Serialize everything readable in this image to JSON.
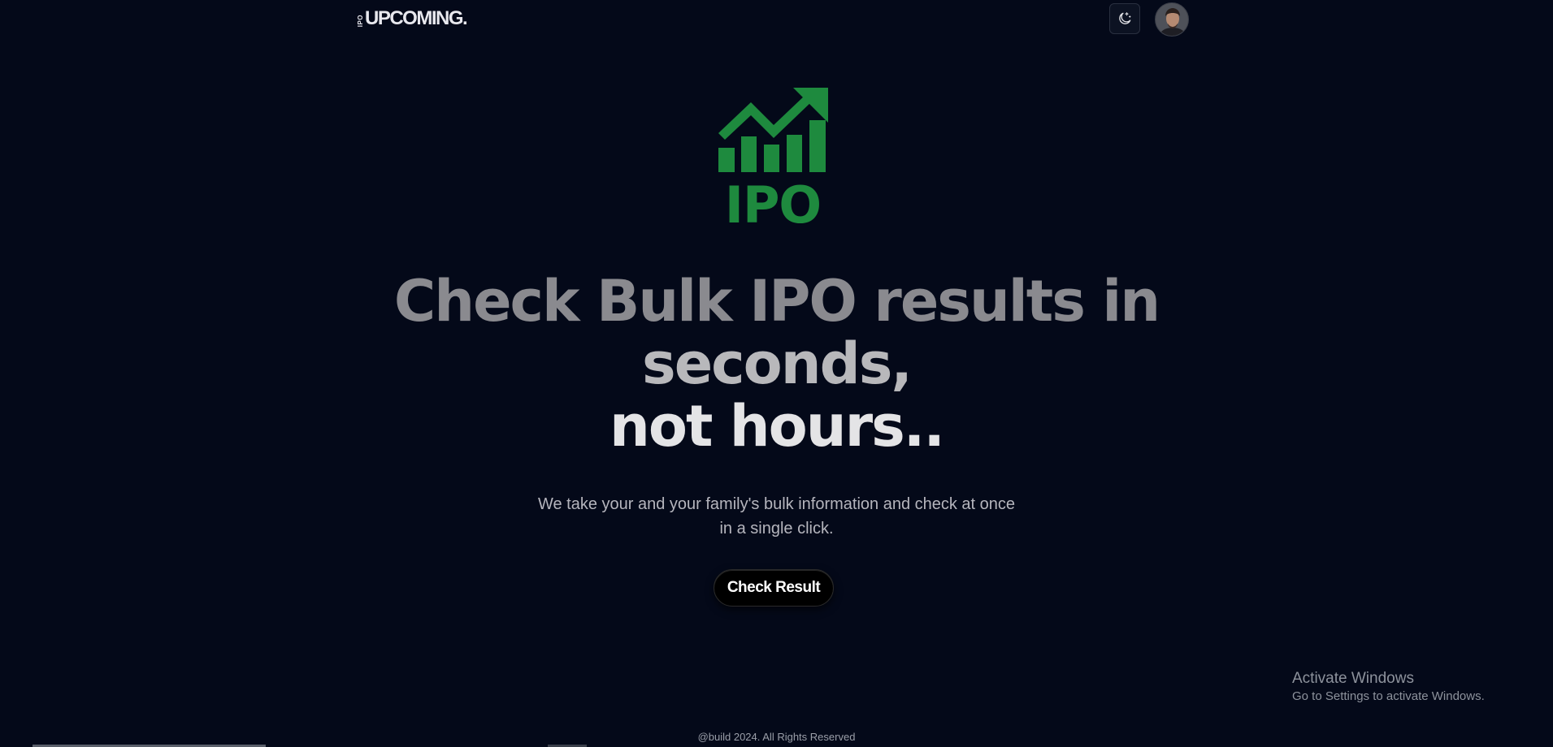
{
  "header": {
    "brand_small": "IPO",
    "brand_main": "UPCOMING.",
    "theme_toggle_icon": "moon-stars-icon",
    "avatar_icon": "user-avatar"
  },
  "hero": {
    "logo_text": "IPO",
    "logo_color": "#1e8a3e",
    "headline_line1": "Check Bulk IPO results in",
    "headline_line2": "seconds,",
    "headline_line3": "not hours..",
    "subtitle_line1": "We take your and your family's bulk information and check at once",
    "subtitle_line2": "in a single click.",
    "cta_label": "Check Result"
  },
  "watermark": {
    "title": "Activate Windows",
    "subtitle": "Go to Settings to activate Windows."
  },
  "footer": {
    "text": "@build 2024. All Rights Reserved"
  },
  "colors": {
    "background": "#040919",
    "accent_green": "#1e8a3e"
  }
}
